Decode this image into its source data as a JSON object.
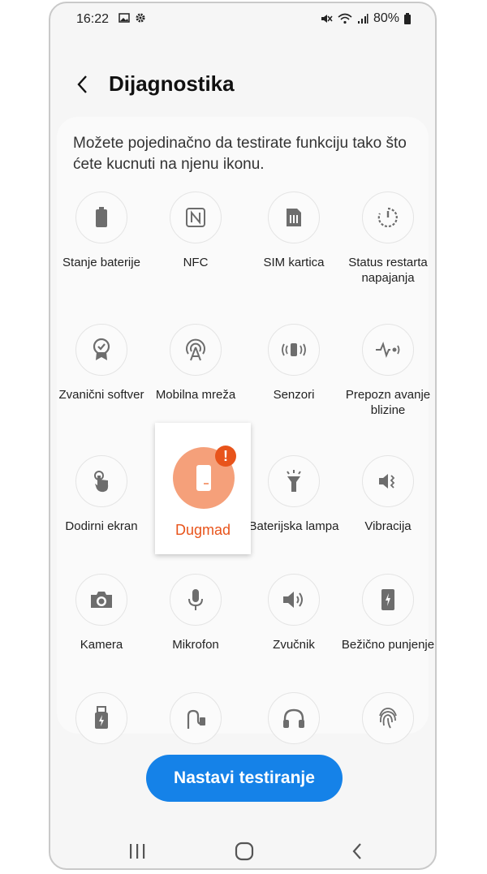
{
  "status_bar": {
    "time": "16:22",
    "battery_percent": "80%"
  },
  "header": {
    "title": "Dijagnostika"
  },
  "description": "Možete pojedinačno da testirate funkciju tako što ćete kucnuti na njenu ikonu.",
  "tests": [
    {
      "label": "Stanje baterije",
      "icon": "battery-icon"
    },
    {
      "label": "NFC",
      "icon": "nfc-icon"
    },
    {
      "label": "SIM kartica",
      "icon": "sim-card-icon"
    },
    {
      "label": "Status restarta napajanja",
      "icon": "power-restart-icon"
    },
    {
      "label": "Zvanični softver",
      "icon": "official-software-badge-icon"
    },
    {
      "label": "Mobilna mreža",
      "icon": "mobile-network-icon"
    },
    {
      "label": "Senzori",
      "icon": "sensor-icon"
    },
    {
      "label": "Prepozn avanje blizine",
      "icon": "proximity-icon"
    },
    {
      "label": "Dodirni ekran",
      "icon": "touch-icon"
    },
    {
      "label": "Dugmad",
      "icon": "buttons-icon",
      "highlighted": true,
      "alert": "!"
    },
    {
      "label": "Baterijska lampa",
      "icon": "flashlight-icon"
    },
    {
      "label": "Vibracija",
      "icon": "vibration-icon"
    },
    {
      "label": "Kamera",
      "icon": "camera-icon"
    },
    {
      "label": "Mikrofon",
      "icon": "microphone-icon"
    },
    {
      "label": "Zvučnik",
      "icon": "speaker-icon"
    },
    {
      "label": "Bežično punjenje",
      "icon": "wireless-charging-icon"
    },
    {
      "label": "",
      "icon": "usb-icon"
    },
    {
      "label": "",
      "icon": "cable-icon"
    },
    {
      "label": "",
      "icon": "headphones-icon"
    },
    {
      "label": "",
      "icon": "fingerprint-icon"
    }
  ],
  "primary_button": {
    "label": "Nastavi testiranje"
  },
  "colors": {
    "accent": "#1582e8",
    "alert": "#e8541b",
    "highlight_circle": "#f5a07a"
  }
}
